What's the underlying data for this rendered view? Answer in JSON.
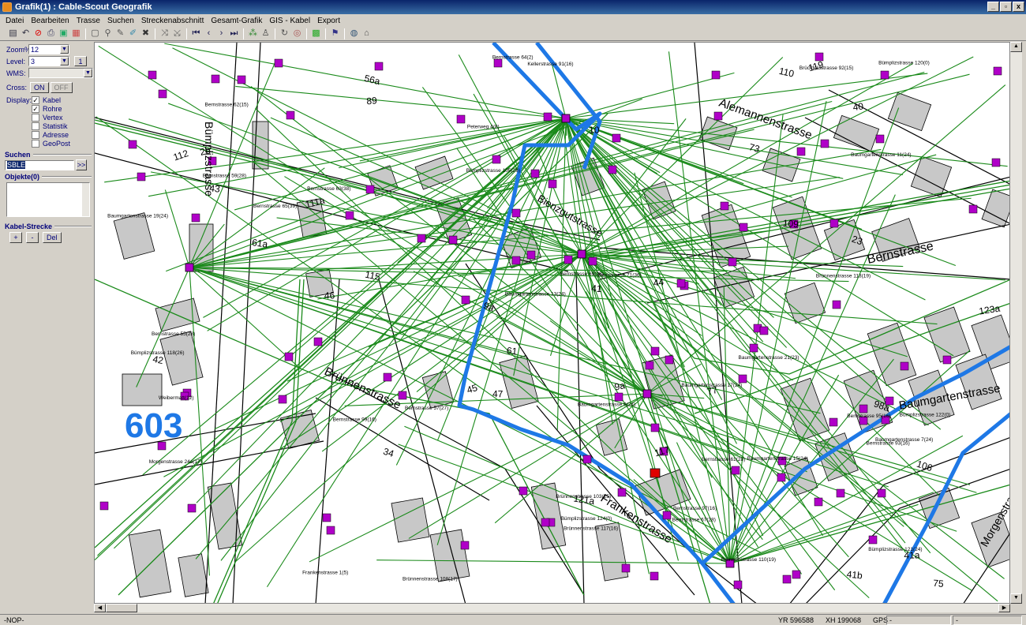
{
  "window": {
    "title": "Grafik(1) : Cable-Scout Geografik",
    "min": "_",
    "max": "̈",
    "close": "x"
  },
  "menu": [
    "Datei",
    "Bearbeiten",
    "Trasse",
    "Suchen",
    "Streckenabschnitt",
    "Gesamt-Grafik",
    "GIS - Kabel",
    "Export"
  ],
  "toolbar_icons": [
    "save-icon",
    "undo-icon",
    "stop-icon",
    "print-icon",
    "export-icon",
    "layers-icon",
    "page-icon",
    "zoom-icon",
    "pen-icon",
    "edit-icon",
    "delete-icon",
    "route-icon",
    "route-edit-icon",
    "first-icon",
    "prev-icon",
    "next-icon",
    "last-icon",
    "node-icon",
    "person-icon",
    "refresh-icon",
    "target-icon",
    "grid-icon",
    "flag-icon",
    "globe-icon",
    "folder-icon"
  ],
  "sidebar": {
    "zoom_label": "Zoom%",
    "zoom_value": "12",
    "level_label": "Level:",
    "level_value": "3",
    "level_btn": "1",
    "wms_label": "WMS:",
    "wms_value": "",
    "cross_label": "Cross:",
    "cross_on": "ON",
    "cross_off": "OFF",
    "display_label": "Display:",
    "display_options": [
      {
        "label": "Kabel",
        "checked": true
      },
      {
        "label": "Rohre",
        "checked": true
      },
      {
        "label": "Vertex",
        "checked": false
      },
      {
        "label": "Statistik",
        "checked": false
      },
      {
        "label": "Adresse",
        "checked": false
      },
      {
        "label": "GeoPost",
        "checked": false
      }
    ],
    "suchen_title": "Suchen",
    "search_value": "SBLE",
    "search_btn": ">>",
    "objekte_title": "Objekte(0)",
    "kabel_title": "Kabel-Strecke",
    "kabel_plus": "+",
    "kabel_minus": "-",
    "kabel_del": "Del"
  },
  "map": {
    "zone_number": "603",
    "streets": [
      "Alemannenstrasse",
      "Bernstrasse",
      "Brünnenstrasse",
      "Baumgartenstrasse",
      "Frankenstrasse",
      "Bümplizstrasse",
      "Morgenstrasse",
      "Bienzgutstrasse"
    ],
    "house_numbers": [
      "98a",
      "34",
      "9a",
      "46",
      "42",
      "40",
      "44",
      "89",
      "47",
      "41",
      "41a",
      "41b",
      "45",
      "56a",
      "43",
      "111a",
      "109",
      "110",
      "106",
      "112",
      "123a",
      "121a",
      "119",
      "117",
      "115",
      "77",
      "75",
      "73",
      "61a",
      "9a",
      "61",
      "2b",
      "23",
      "10"
    ],
    "labels": [
      "Kellerstrasse 91(16)",
      "Brünnenstrasse 103(25)",
      "Bümplizstrasse 105(26)",
      "Weibermatt(12)",
      "Peterweg 4(8)",
      "Brückfeldstrasse 92(15)",
      "Bernstrasse 93(16)",
      "Bernstrasse 95(16)",
      "Bernstrasse 97(16)",
      "Bernstrasse 99(16)",
      "Bernstrasse 64(2)",
      "Bernstrasse 62(15)",
      "Bernstrasse 55(28)",
      "Bernstrasse 59(28)",
      "Bernstrasse 57(27)",
      "Bernstrasse 63(38)",
      "Bernstrasse 61(28)",
      "Bernstrasse 67(28)",
      "Bernstrasse 65(39)",
      "Bernstrasse 69(28)",
      "Bernstrasse 71(36)",
      "Brünnenstrasse 117(16)",
      "Brünnenstrasse 113(19)",
      "Brünnenstrasse 108(17)",
      "Brünnenstrasse 110(19)",
      "Frankenstrasse 1(5)",
      "Baumgartenstrasse 7(24)",
      "Baumgartenstrasse 9(24)",
      "Baumgartenstrasse 11(24)",
      "Baumgartenstrasse 13(24)",
      "Baumgartenstrasse 15(24)",
      "Baumgartenstrasse 17(24)",
      "Baumgartenstrasse 19(24)",
      "Baumgartenstrasse 21(23)",
      "Bümplizstrasse 118(26)",
      "Bümplizstrasse 120(0)",
      "Bümplizstrasse 122(0)",
      "Bümplizstrasse 124(0)",
      "Bümplizstrasse 121(24)",
      "Morgenstrasse 24a(17)"
    ]
  },
  "status": {
    "nop": "-NOP-",
    "yr_label": "YR",
    "yr_value": "596588",
    "xh_label": "XH",
    "xh_value": "199068",
    "gps_label": "GPS",
    "gps_value": "-",
    "extra": "-"
  },
  "colors": {
    "cable": "#1a8a1a",
    "route": "#1e78e6",
    "node": "#b000c8",
    "alert": "#e00000",
    "building": "#c8c8c8",
    "zone": "#1e78e6"
  }
}
